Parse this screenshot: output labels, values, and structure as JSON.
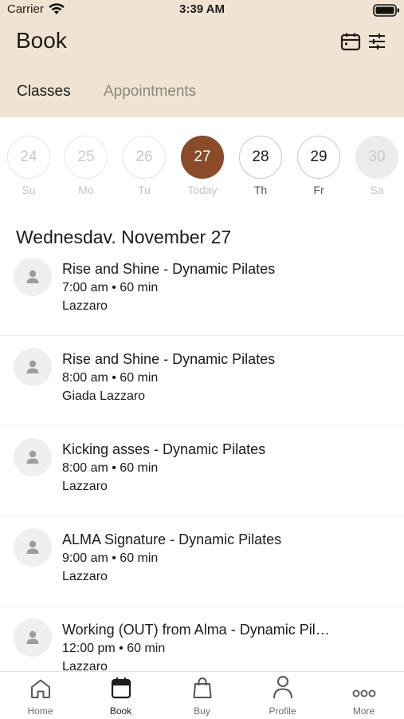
{
  "status_bar": {
    "carrier": "Carrier",
    "time": "3:39 AM"
  },
  "header": {
    "title": "Book",
    "tabs": [
      {
        "label": "Classes",
        "active": true
      },
      {
        "label": "Appointments",
        "active": false
      }
    ]
  },
  "dates": [
    {
      "day": "24",
      "dow": "Su",
      "state": "faded"
    },
    {
      "day": "25",
      "dow": "Mo",
      "state": "faded"
    },
    {
      "day": "26",
      "dow": "Tu",
      "state": "faded"
    },
    {
      "day": "27",
      "dow": "Today",
      "state": "selected"
    },
    {
      "day": "28",
      "dow": "Th",
      "state": "active"
    },
    {
      "day": "29",
      "dow": "Fr",
      "state": "active"
    },
    {
      "day": "30",
      "dow": "Sa",
      "state": "dim"
    }
  ],
  "day_heading": "Wednesdav. November 27",
  "classes": [
    {
      "name": "Rise and Shine - Dynamic Pilates",
      "time": "7:00 am • 60 min",
      "instructor": "Lazzaro"
    },
    {
      "name": "Rise and Shine - Dynamic Pilates",
      "time": "8:00 am • 60 min",
      "instructor": "Giada Lazzaro"
    },
    {
      "name": "Kicking asses - Dynamic Pilates",
      "time": "8:00 am • 60 min",
      "instructor": "Lazzaro"
    },
    {
      "name": "ALMA Signature - Dynamic Pilates",
      "time": "9:00 am • 60 min",
      "instructor": "Lazzaro"
    },
    {
      "name": "Working (OUT) from Alma - Dynamic Pil…",
      "time": "12:00 pm • 60 min",
      "instructor": "Lazzaro"
    }
  ],
  "tabbar": [
    {
      "label": "Home",
      "icon": "home-icon"
    },
    {
      "label": "Book",
      "icon": "calendar-icon",
      "current": true
    },
    {
      "label": "Buy",
      "icon": "shopping-bag-icon"
    },
    {
      "label": "Profile",
      "icon": "person-icon"
    },
    {
      "label": "More",
      "icon": "more-icon"
    }
  ],
  "colors": {
    "header_bg": "#f0e3d2",
    "accent": "#8b4a28"
  }
}
